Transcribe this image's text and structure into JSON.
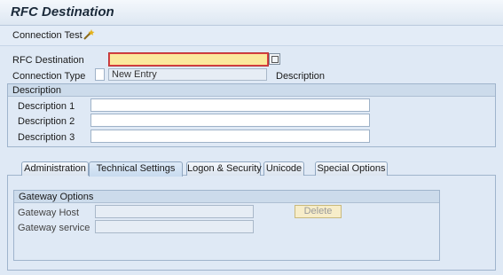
{
  "window": {
    "title": "RFC Destination"
  },
  "toolbar": {
    "connection_test": "Connection Test",
    "wand_icon": "magic-wand-icon"
  },
  "header": {
    "rfc_destination_label": "RFC Destination",
    "rfc_destination_value": "",
    "connection_type_label": "Connection Type",
    "connection_type_value": "",
    "connection_type_desc": "New Entry",
    "description_label": "Description"
  },
  "description_group": {
    "title": "Description",
    "fields": [
      {
        "label": "Description 1",
        "value": ""
      },
      {
        "label": "Description 2",
        "value": ""
      },
      {
        "label": "Description 3",
        "value": ""
      }
    ]
  },
  "tabs": [
    {
      "label": "Administration"
    },
    {
      "label": "Technical Settings"
    },
    {
      "label": "Logon & Security"
    },
    {
      "label": "Unicode"
    },
    {
      "label": "Special Options"
    }
  ],
  "gateway_group": {
    "title": "Gateway Options",
    "host_label": "Gateway Host",
    "host_value": "",
    "service_label": "Gateway service",
    "service_value": "",
    "delete_label": "Delete"
  }
}
